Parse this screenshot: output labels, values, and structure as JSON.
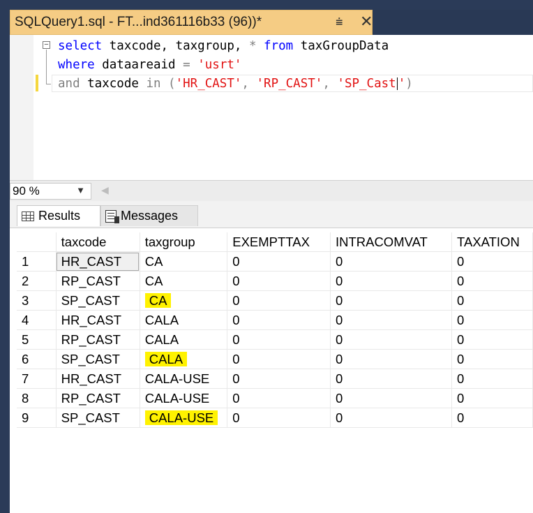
{
  "tab": {
    "title": "SQLQuery1.sql - FT...ind361116b33 (96))*"
  },
  "editor": {
    "line1": {
      "kw1": "select",
      "t1": " taxcode, taxgroup, ",
      "star": "*",
      "kw2": " from",
      "t2": " taxGroupData"
    },
    "line2": {
      "kw1": "where",
      "t1": " dataareaid ",
      "op": "=",
      "sp": " ",
      "s1": "'usrt'"
    },
    "line3": {
      "op1": "and",
      "t1": " taxcode ",
      "op2": "in",
      "p1": " (",
      "s1": "'HR_CAST'",
      "c1": ", ",
      "s2": "'RP_CAST'",
      "c2": ", ",
      "s3": "'SP_Cast",
      "s3end": "'",
      "p2": ")"
    }
  },
  "zoom": {
    "value": "90 %"
  },
  "results_tabs": {
    "results": "Results",
    "messages": "Messages"
  },
  "grid": {
    "columns": [
      "taxcode",
      "taxgroup",
      "EXEMPTTAX",
      "INTRACOMVAT",
      "TAXATION"
    ],
    "rows": [
      {
        "n": "1",
        "taxcode": "HR_CAST",
        "taxgroup": "CA",
        "exempttax": "0",
        "intracomvat": "0",
        "taxation": "0"
      },
      {
        "n": "2",
        "taxcode": "RP_CAST",
        "taxgroup": "CA",
        "exempttax": "0",
        "intracomvat": "0",
        "taxation": "0"
      },
      {
        "n": "3",
        "taxcode": "SP_CAST",
        "taxgroup": "CA",
        "exempttax": "0",
        "intracomvat": "0",
        "taxation": "0"
      },
      {
        "n": "4",
        "taxcode": "HR_CAST",
        "taxgroup": "CALA",
        "exempttax": "0",
        "intracomvat": "0",
        "taxation": "0"
      },
      {
        "n": "5",
        "taxcode": "RP_CAST",
        "taxgroup": "CALA",
        "exempttax": "0",
        "intracomvat": "0",
        "taxation": "0"
      },
      {
        "n": "6",
        "taxcode": "SP_CAST",
        "taxgroup": "CALA",
        "exempttax": "0",
        "intracomvat": "0",
        "taxation": "0"
      },
      {
        "n": "7",
        "taxcode": "HR_CAST",
        "taxgroup": "CALA-USE",
        "exempttax": "0",
        "intracomvat": "0",
        "taxation": "0"
      },
      {
        "n": "8",
        "taxcode": "RP_CAST",
        "taxgroup": "CALA-USE",
        "exempttax": "0",
        "intracomvat": "0",
        "taxation": "0"
      },
      {
        "n": "9",
        "taxcode": "SP_CAST",
        "taxgroup": "CALA-USE",
        "exempttax": "0",
        "intracomvat": "0",
        "taxation": "0"
      }
    ]
  },
  "colors": {
    "tab_bg": "#f5cc84",
    "highlight": "#fff200",
    "keyword": "#0000ff",
    "string": "#e21313",
    "frame": "#293955"
  },
  "icons": {
    "pin": "pin-icon",
    "close": "close-icon",
    "collapse": "collapse-icon",
    "results": "grid-icon",
    "messages": "messages-icon"
  }
}
